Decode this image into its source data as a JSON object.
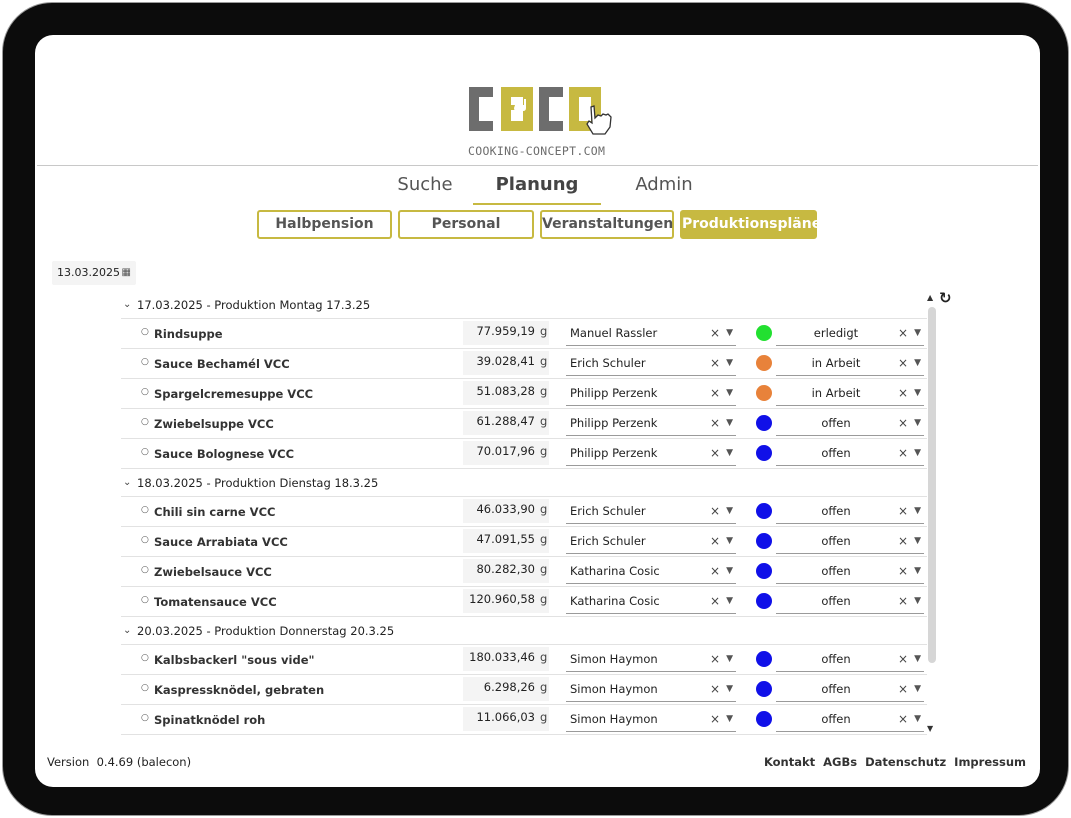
{
  "logo": {
    "wordmark": "COCO",
    "tagline": "COOKING-CONCEPT.COM"
  },
  "nav": {
    "tabs": [
      {
        "label": "Suche"
      },
      {
        "label": "Planung"
      },
      {
        "label": "Admin"
      }
    ],
    "active_tab": "Planung"
  },
  "subnav": {
    "buttons": [
      {
        "label": "Halbpension"
      },
      {
        "label": "Personal"
      },
      {
        "label": "Veranstaltungen"
      },
      {
        "label": "Produktionspläne"
      }
    ],
    "active": "Produktionspläne"
  },
  "date_filter": {
    "value": "13.03.2025",
    "icon": "calendar-icon"
  },
  "groups": [
    {
      "title": "17.03.2025 - Produktion Montag 17.3.25",
      "rows": [
        {
          "name": "Rindsuppe",
          "amount": "77.959,19",
          "unit": "g",
          "person": "Manuel Rassler",
          "status": "erledigt",
          "status_color": "#22e030"
        },
        {
          "name": "Sauce Bechamél VCC",
          "amount": "39.028,41",
          "unit": "g",
          "person": "Erich Schuler",
          "status": "in Arbeit",
          "status_color": "#e8823a"
        },
        {
          "name": "Spargelcremesuppe VCC",
          "amount": "51.083,28",
          "unit": "g",
          "person": "Philipp Perzenk",
          "status": "in Arbeit",
          "status_color": "#e8823a"
        },
        {
          "name": "Zwiebelsuppe VCC",
          "amount": "61.288,47",
          "unit": "g",
          "person": "Philipp Perzenk",
          "status": "offen",
          "status_color": "#1010e8"
        },
        {
          "name": "Sauce Bolognese VCC",
          "amount": "70.017,96",
          "unit": "g",
          "person": "Philipp Perzenk",
          "status": "offen",
          "status_color": "#1010e8"
        }
      ]
    },
    {
      "title": "18.03.2025 - Produktion Dienstag 18.3.25",
      "rows": [
        {
          "name": "Chili sin carne VCC",
          "amount": "46.033,90",
          "unit": "g",
          "person": "Erich Schuler",
          "status": "offen",
          "status_color": "#1010e8"
        },
        {
          "name": "Sauce Arrabiata VCC",
          "amount": "47.091,55",
          "unit": "g",
          "person": "Erich Schuler",
          "status": "offen",
          "status_color": "#1010e8"
        },
        {
          "name": "Zwiebelsauce VCC",
          "amount": "80.282,30",
          "unit": "g",
          "person": "Katharina Cosic",
          "status": "offen",
          "status_color": "#1010e8"
        },
        {
          "name": "Tomatensauce VCC",
          "amount": "120.960,58",
          "unit": "g",
          "person": "Katharina Cosic",
          "status": "offen",
          "status_color": "#1010e8"
        }
      ]
    },
    {
      "title": "20.03.2025 - Produktion Donnerstag 20.3.25",
      "rows": [
        {
          "name": "Kalbsbackerl \"sous vide\"",
          "amount": "180.033,46",
          "unit": "g",
          "person": "Simon Haymon",
          "status": "offen",
          "status_color": "#1010e8"
        },
        {
          "name": "Kaspressknödel, gebraten",
          "amount": "6.298,26",
          "unit": "g",
          "person": "Simon Haymon",
          "status": "offen",
          "status_color": "#1010e8"
        },
        {
          "name": "Spinatknödel roh",
          "amount": "11.066,03",
          "unit": "g",
          "person": "Simon Haymon",
          "status": "offen",
          "status_color": "#1010e8"
        }
      ]
    }
  ],
  "clear_glyph": "×",
  "footer": {
    "version_label": "Version",
    "version_value": "0.4.69 (balecon)",
    "links": [
      "Kontakt",
      "AGBs",
      "Datenschutz",
      "Impressum"
    ]
  },
  "colors": {
    "accent": "#c7b941",
    "logo_grey": "#6d6d6d"
  }
}
